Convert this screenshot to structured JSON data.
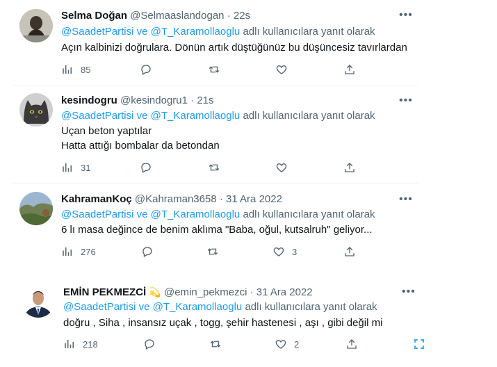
{
  "reply_prefix": "adlı kullanıcılara yanıt olarak",
  "reply_and": "ve",
  "tweets": [
    {
      "name": "Selma Doğan",
      "handle": "@Selmaaslandogan",
      "dot": "·",
      "time": "22s",
      "mention1": "@SaadetPartisi",
      "mention2": "@T_Karamollaoglu",
      "lines": [
        "Açın kalbinizi doğrulara. Dönün artık düştüğünüz bu düşüncesiz tavırlardan"
      ],
      "views": "85",
      "likes": ""
    },
    {
      "name": "kesindogru",
      "handle": "@kesindogru1",
      "dot": "·",
      "time": "21s",
      "mention1": "@SaadetPartisi",
      "mention2": "@T_Karamollaoglu",
      "lines": [
        "Uçan beton yaptılar",
        "Hatta attığı bombalar da betondan"
      ],
      "views": "31",
      "likes": ""
    },
    {
      "name": "KahramanKoç",
      "handle": "@Kahraman3658",
      "dot": "·",
      "time": "31 Ara 2022",
      "mention1": "@SaadetPartisi",
      "mention2": "@T_Karamollaoglu",
      "lines": [
        "6 lı masa değince de benim aklıma \"Baba, oğul, kutsalruh\" geliyor..."
      ],
      "views": "276",
      "likes": "3"
    },
    {
      "name": "EMİN PEKMEZCİ",
      "badge": "💫",
      "handle": "@emin_pekmezci",
      "dot": "·",
      "time": "31 Ara 2022",
      "mention1": "@SaadetPartisi",
      "mention2": "@T_Karamollaoglu",
      "lines": [
        "doğru , Siha , insansız uçak , togg, şehir hastenesi ,  aşı , gibi değil mi"
      ],
      "views": "218",
      "likes": "2"
    }
  ],
  "icons": {
    "more": "more-icon",
    "views": "views-icon",
    "reply": "reply-icon",
    "retweet": "retweet-icon",
    "like": "like-icon",
    "share": "share-icon",
    "expand": "expand-icon"
  },
  "colors": {
    "accent": "#1d9bf0",
    "muted": "#536471",
    "text": "#0f1419"
  }
}
